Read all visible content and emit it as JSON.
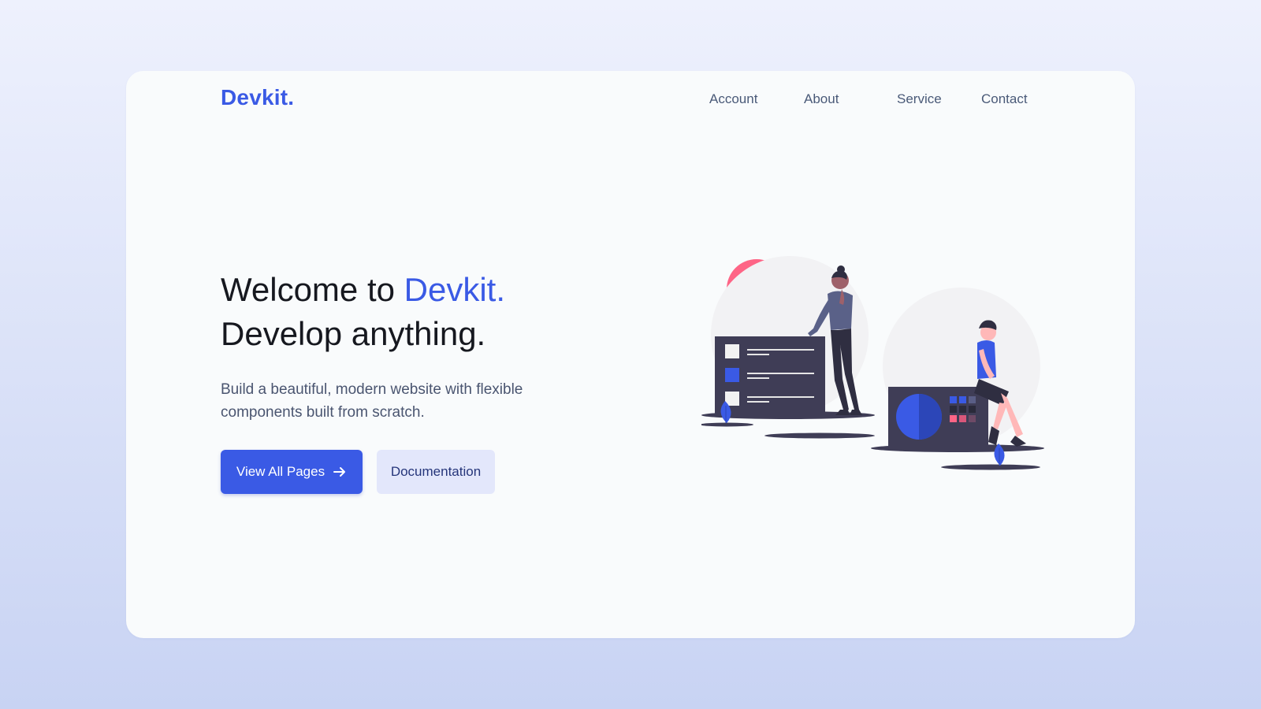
{
  "brand": {
    "name": "Devkit.",
    "color": "#3a5ae5"
  },
  "nav": {
    "items": [
      {
        "label": "Account"
      },
      {
        "label": "About"
      },
      {
        "label": "Service"
      },
      {
        "label": "Contact"
      }
    ]
  },
  "hero": {
    "title_prefix": "Welcome to",
    "title_accent": "Devkit.",
    "title_line2": "Develop anything.",
    "description": "Build a beautiful, modern website with flexible components built from scratch."
  },
  "buttons": {
    "primary_label": "View All Pages",
    "primary_icon": "arrow-right-icon",
    "secondary_label": "Documentation"
  },
  "colors": {
    "accent": "#3a5ae5",
    "secondary_bg": "#e3e7fb",
    "pink": "#fe6586",
    "dark": "#3f3d56",
    "card_bg": "#f9fbfc"
  },
  "illustration": {
    "icon": "people-with-dashboards-illustration"
  }
}
